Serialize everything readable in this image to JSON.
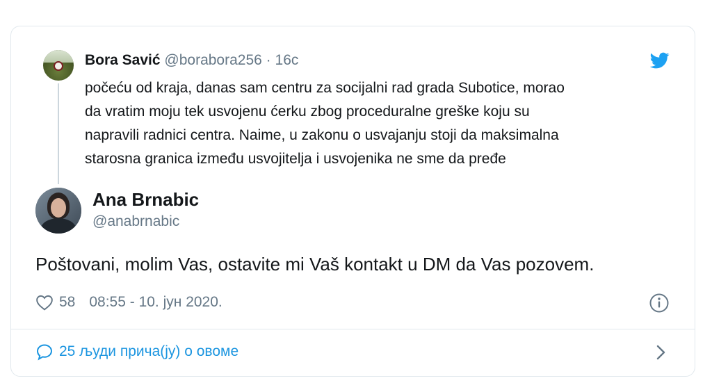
{
  "parent_tweet": {
    "name": "Bora Savić",
    "handle": "@borabora256",
    "dot": "·",
    "time": "16c",
    "lines": [
      "počeću od kraja, danas sam centru za socijalni rad grada Subotice, morao",
      "da vratim moju tek usvojenu ćerku zbog proceduralne greške koju su",
      "napravili radnici centra. Naime, u zakonu o usvajanju stoji da maksimalna",
      "starosna granica između usvojitelja i usvojenika ne sme da pređe"
    ]
  },
  "tweet": {
    "name": "Ana Brnabic",
    "handle": "@anabrnabic",
    "text": "Poštovani, molim Vas, ostavite mi Vaš kontakt u DM da Vas pozovem.",
    "likes": "58",
    "timestamp": "08:55 - 10. јун 2020."
  },
  "conversation": {
    "label": "25 људи прича(ју) о овоме"
  },
  "icons": {
    "brand": "twitter-bird-icon",
    "like": "heart-icon",
    "info": "info-icon",
    "reply": "speech-bubble-icon",
    "more": "chevron-right-icon"
  },
  "colors": {
    "brand_blue": "#1da1f2",
    "link_blue": "#1b95e0",
    "secondary_text": "#657786",
    "primary_text": "#14171a",
    "border": "#e1e8ed"
  }
}
